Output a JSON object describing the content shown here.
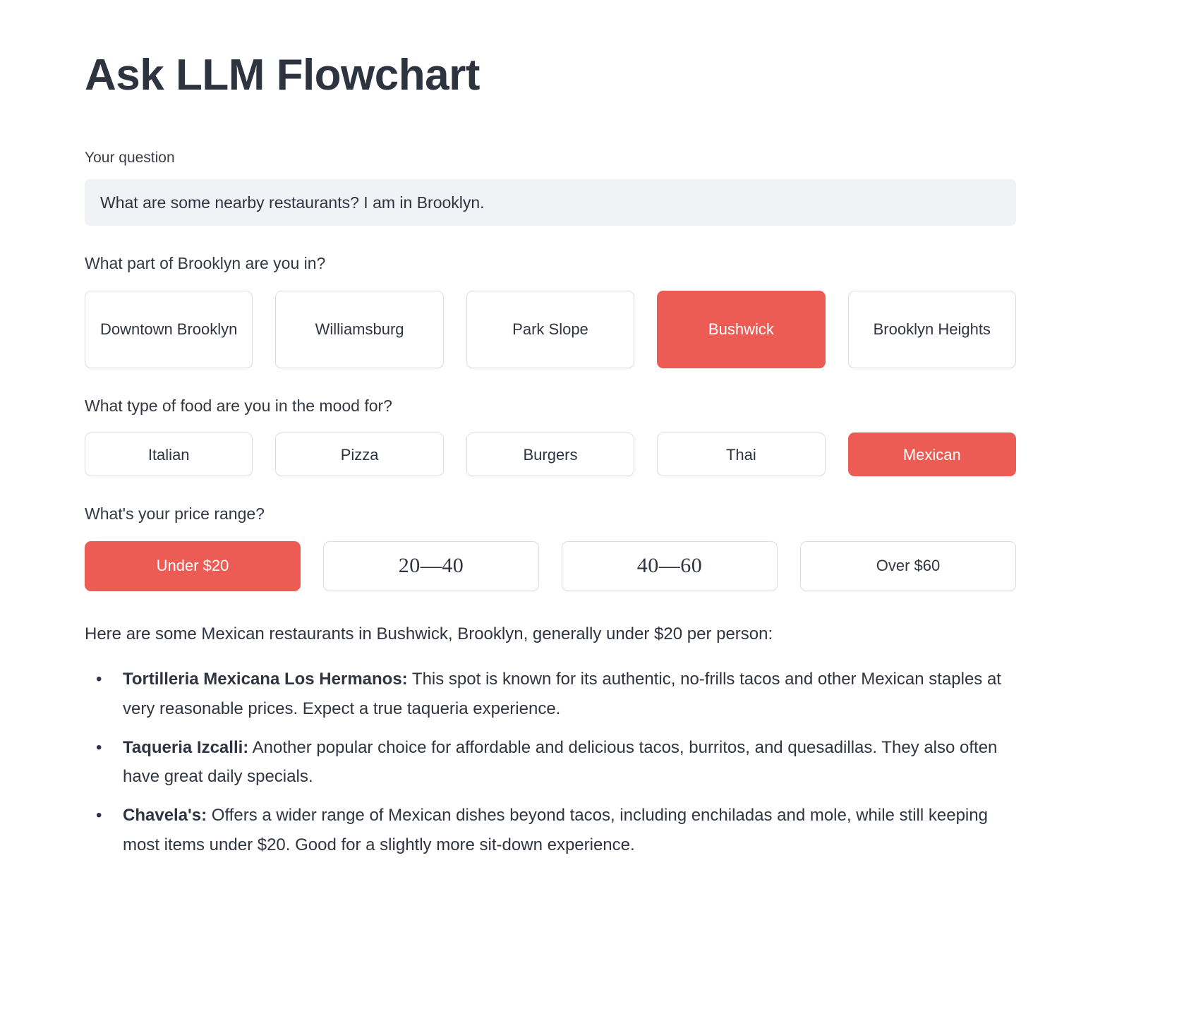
{
  "header": {
    "title": "Ask LLM Flowchart"
  },
  "question": {
    "label": "Your question",
    "value": "What are some nearby restaurants? I am in Brooklyn.",
    "placeholder": "What are some nearby restaurants? I am in Brooklyn."
  },
  "colors": {
    "accent": "#ec5c55",
    "text": "#2f3440",
    "input_bg": "#f1f2f6",
    "border": "#dcdee3"
  },
  "groups": [
    {
      "id": "neighborhood",
      "label": "What part of Brooklyn are you in?",
      "options": [
        {
          "label": "Downtown Brooklyn",
          "selected": false
        },
        {
          "label": "Williamsburg",
          "selected": false
        },
        {
          "label": "Park Slope",
          "selected": false
        },
        {
          "label": "Bushwick",
          "selected": true
        },
        {
          "label": "Brooklyn Heights",
          "selected": false
        }
      ]
    },
    {
      "id": "cuisine",
      "label": "What type of food are you in the mood for?",
      "options": [
        {
          "label": "Italian",
          "selected": false
        },
        {
          "label": "Pizza",
          "selected": false
        },
        {
          "label": "Burgers",
          "selected": false
        },
        {
          "label": "Thai",
          "selected": false
        },
        {
          "label": "Mexican",
          "selected": true
        }
      ]
    },
    {
      "id": "price",
      "label": "What's your price range?",
      "options": [
        {
          "label": "Under $20",
          "selected": true,
          "style": "sans"
        },
        {
          "label": "20—40",
          "selected": false,
          "style": "serif"
        },
        {
          "label": "40—60",
          "selected": false,
          "style": "serif"
        },
        {
          "label": "Over $60",
          "selected": false,
          "style": "sans"
        }
      ]
    }
  ],
  "answer": {
    "intro": "Here are some Mexican restaurants in Bushwick, Brooklyn, generally under $20 per person:",
    "items": [
      {
        "name": "Tortilleria Mexicana Los Hermanos:",
        "text": " This spot is known for its authentic, no-frills tacos and other Mexican staples at very reasonable prices. Expect a true taqueria experience."
      },
      {
        "name": "Taqueria Izcalli:",
        "text": " Another popular choice for affordable and delicious tacos, burritos, and quesadillas. They also often have great daily specials."
      },
      {
        "name": "Chavela's:",
        "text": " Offers a wider range of Mexican dishes beyond tacos, including enchiladas and mole, while still keeping most items under $20. Good for a slightly more sit-down experience."
      }
    ]
  }
}
